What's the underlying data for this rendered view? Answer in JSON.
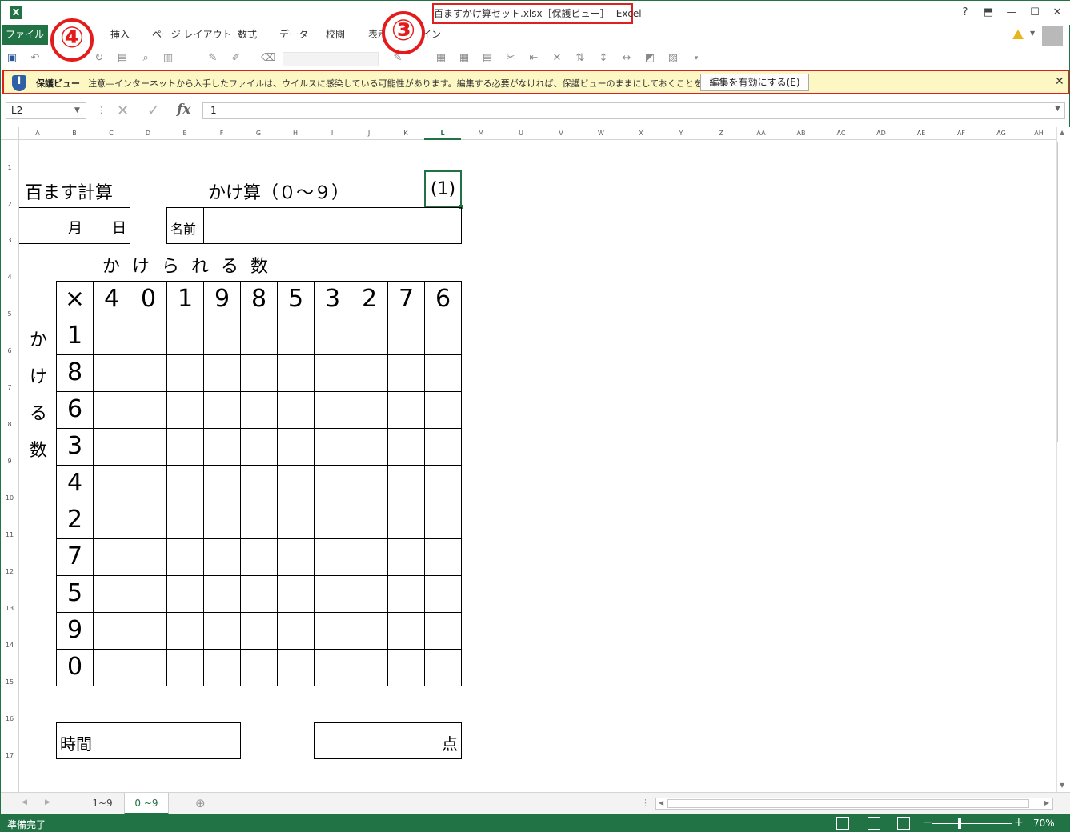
{
  "window": {
    "title": "百ますかけ算セット.xlsx［保護ビュー］- Excel",
    "help_label": "?",
    "minimize_label": "—",
    "maximize_label": "☐",
    "close_label": "✕"
  },
  "ribbon": {
    "file_label": "ファイル",
    "tabs": [
      {
        "label": "挿入"
      },
      {
        "label": "ページ レイアウト"
      },
      {
        "label": "数式"
      },
      {
        "label": "データ"
      },
      {
        "label": "校閲"
      },
      {
        "label": "表示"
      },
      {
        "label": "デザイン"
      }
    ]
  },
  "annotations": {
    "step3": "③",
    "step4": "④"
  },
  "protected_view": {
    "title": "保護ビュー",
    "message": "注意―インターネットから入手したファイルは、ウイルスに感染している可能性があります。編集する必要がなければ、保護ビューのままにしておくことをお勧めします。",
    "enable_button": "編集を有効にする(E)",
    "close_label": "✕"
  },
  "formula_bar": {
    "name_box": "L2",
    "cancel_label": "✕",
    "enter_label": "✓",
    "fx_label": "fx",
    "value": "1"
  },
  "columns": [
    "A",
    "B",
    "C",
    "D",
    "E",
    "F",
    "G",
    "H",
    "I",
    "J",
    "K",
    "L",
    "M",
    "U",
    "V",
    "W",
    "X",
    "Y",
    "Z",
    "AA",
    "AB",
    "AC",
    "AD",
    "AE",
    "AF",
    "AG",
    "AH"
  ],
  "active_column": "L",
  "rows": [
    "1",
    "2",
    "3",
    "4",
    "5",
    "6",
    "7",
    "8",
    "9",
    "10",
    "11",
    "12",
    "13",
    "14",
    "15",
    "16",
    "17"
  ],
  "worksheet": {
    "title_left": "百ます計算",
    "title_center": "かけ算（０～９）",
    "sheet_number": "(1)",
    "month_label": "月",
    "day_label": "日",
    "name_label": "名前",
    "multiplicand_label": "か け ら れ る 数",
    "multiplier_label": [
      "か",
      "け",
      "る",
      "数"
    ],
    "operator": "×",
    "multiplicands": [
      "4",
      "0",
      "1",
      "9",
      "8",
      "5",
      "3",
      "2",
      "7",
      "6"
    ],
    "multipliers": [
      "1",
      "8",
      "6",
      "3",
      "4",
      "2",
      "7",
      "5",
      "9",
      "0"
    ],
    "time_label": "時間",
    "score_label": "点"
  },
  "sheet_tabs": [
    {
      "label": "1~9",
      "active": false
    },
    {
      "label": "0 ~9",
      "active": true
    }
  ],
  "add_sheet_label": "⊕",
  "status": {
    "ready": "準備完了",
    "zoom": "70%"
  },
  "colors": {
    "excel_green": "#217346",
    "annotation_red": "#e41b1b",
    "protected_bar_bg": "#fdf7c3"
  }
}
